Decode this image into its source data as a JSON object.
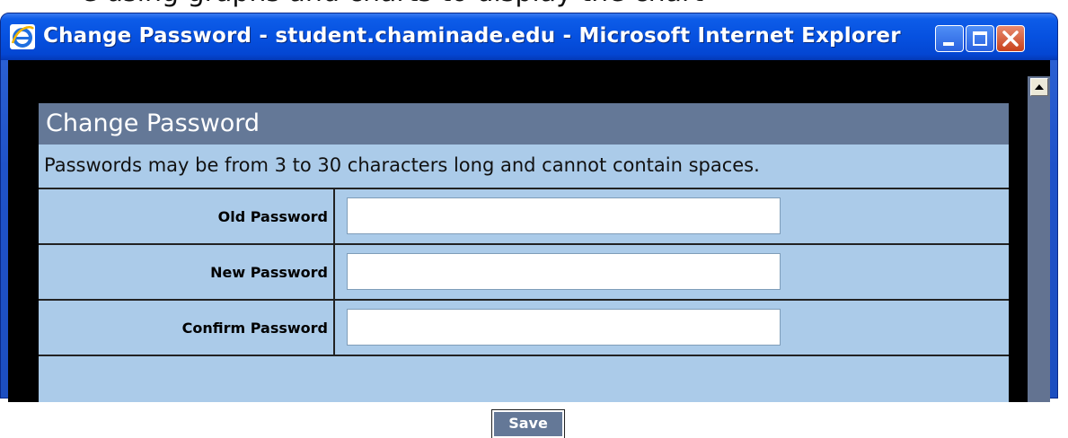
{
  "page_above": {
    "clipped_text": "e using graphs and charts to display the chart"
  },
  "window": {
    "title": "Change Password - student.chaminade.edu - Microsoft Internet Explorer",
    "icon": "internet-explorer-icon",
    "controls": {
      "minimize": "minimize-icon",
      "maximize": "maximize-icon",
      "close": "close-icon"
    }
  },
  "form": {
    "title": "Change Password",
    "instructions": "Passwords may be from 3 to 30 characters long and cannot contain spaces.",
    "fields": [
      {
        "label": "Old Password",
        "value": ""
      },
      {
        "label": "New Password",
        "value": ""
      },
      {
        "label": "Confirm Password",
        "value": ""
      }
    ],
    "save_label": "Save"
  },
  "colors": {
    "header": "#647897",
    "form_background": "#abcbe9",
    "scrollbar": "#637391",
    "client_background": "#000000"
  }
}
